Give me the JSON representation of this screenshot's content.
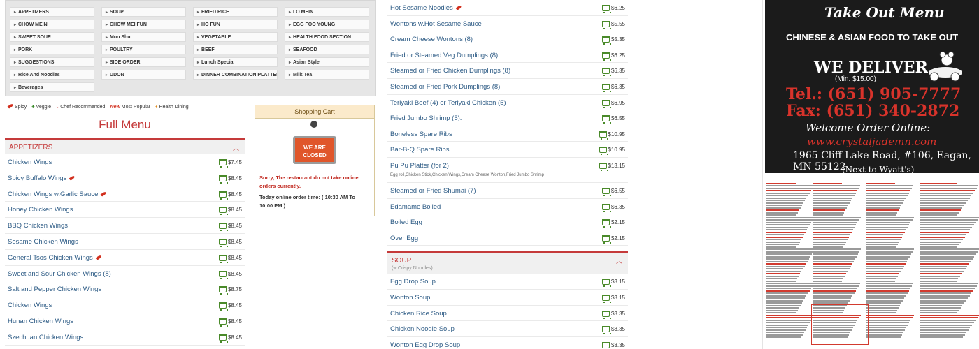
{
  "categories": [
    "APPETIZERS",
    "SOUP",
    "FRIED RICE",
    "LO MEIN",
    "CHOW MEIN",
    "CHOW MEI FUN",
    "HO FUN",
    "EGG FOO YOUNG",
    "SWEET SOUR",
    "Moo Shu",
    "VEGETABLE",
    "HEALTH FOOD SECTION",
    "PORK",
    "POULTRY",
    "BEEF",
    "SEAFOOD",
    "SUGGESTIONS",
    "SIDE ORDER",
    "Lunch Special",
    "Asian Style",
    "Rice And Noodles",
    "UDON",
    "DINNER COMBINATION PLATTER",
    "Milk Tea",
    "Beverages"
  ],
  "legend": {
    "spicy": "Spicy",
    "veggie": "Veggie",
    "chef": "Chef Recommended",
    "new": "New",
    "popular": "Most Popular",
    "health": "Health Dining"
  },
  "full_menu_title": "Full Menu",
  "appetizers_header": "APPETIZERS",
  "appetizers": [
    {
      "name": "Chicken Wings",
      "price": "$7.45",
      "spicy": false
    },
    {
      "name": "Spicy Buffalo Wings",
      "price": "$8.45",
      "spicy": true
    },
    {
      "name": "Chicken Wings w.Garlic Sauce",
      "price": "$8.45",
      "spicy": true
    },
    {
      "name": "Honey Chicken Wings",
      "price": "$8.45",
      "spicy": false
    },
    {
      "name": "BBQ Chicken Wings",
      "price": "$8.45",
      "spicy": false
    },
    {
      "name": "Sesame Chicken Wings",
      "price": "$8.45",
      "spicy": false
    },
    {
      "name": "General Tsos Chicken Wings",
      "price": "$8.45",
      "spicy": true
    },
    {
      "name": "Sweet and Sour Chicken Wings (8)",
      "price": "$8.45",
      "spicy": false
    },
    {
      "name": "Salt and Pepper Chicken Wings",
      "price": "$8.75",
      "spicy": false
    },
    {
      "name": "Chicken Wings",
      "price": "$8.45",
      "spicy": false
    },
    {
      "name": "Hunan Chicken Wings",
      "price": "$8.45",
      "spicy": false
    },
    {
      "name": "Szechuan Chicken Wings",
      "price": "$8.45",
      "spicy": false
    }
  ],
  "cart": {
    "header": "Shopping Cart",
    "sign_text_1": "WE ARE",
    "sign_text_2": "CLOSED",
    "closed_msg": "Sorry, The restaurant do not take online orders currently.",
    "time_msg": "Today online order time: ( 10:30 AM   To 10:00 PM )"
  },
  "middle_items": [
    {
      "name": "Hot Sesame Noodles",
      "price": "$6.25",
      "spicy": true
    },
    {
      "name": "Wontons w.Hot Sesame Sauce",
      "price": "$5.55",
      "spicy": false
    },
    {
      "name": "Cream Cheese Wontons (8)",
      "price": "$5.35",
      "spicy": false
    },
    {
      "name": "Fried or Steamed Veg.Dumplings (8)",
      "price": "$6.25",
      "spicy": false
    },
    {
      "name": "Steamed or Fried Chicken Dumplings (8)",
      "price": "$6.35",
      "spicy": false
    },
    {
      "name": "Steamed or Fried Pork Dumplings (8)",
      "price": "$6.35",
      "spicy": false
    },
    {
      "name": "Teriyaki Beef (4) or Teriyaki Chicken (5)",
      "price": "$6.95",
      "spicy": false
    },
    {
      "name": "Fried Jumbo Shrimp (5).",
      "price": "$6.55",
      "spicy": false
    },
    {
      "name": "Boneless Spare Ribs",
      "price": "$10.95",
      "spicy": false
    },
    {
      "name": "Bar-B-Q Spare Ribs.",
      "price": "$10.95",
      "spicy": false
    },
    {
      "name": "Pu Pu Platter (for 2)",
      "price": "$13.15",
      "spicy": false,
      "note": "Egg roll,Chicken Stick,Chicken Wings,Cream Cheese Wonton,Fried Jumbo Shrimp"
    },
    {
      "name": "Steamed or Fried Shumai (7)",
      "price": "$6.55",
      "spicy": false
    },
    {
      "name": "Edamame Boiled",
      "price": "$6.35",
      "spicy": false
    },
    {
      "name": "Boiled Egg",
      "price": "$2.15",
      "spicy": false
    },
    {
      "name": "Over Egg",
      "price": "$2.15",
      "spicy": false
    }
  ],
  "soup_header": "SOUP",
  "soup_sub": "(w.Crispy Noodles)",
  "soups": [
    {
      "name": "Egg Drop Soup",
      "price": "$3.15"
    },
    {
      "name": "Wonton Soup",
      "price": "$3.15"
    },
    {
      "name": "Chicken Rice Soup",
      "price": "$3.35"
    },
    {
      "name": "Chicken Noodle Soup",
      "price": "$3.35"
    },
    {
      "name": "Wonton Egg Drop Soup",
      "price": "$3.35"
    }
  ],
  "menu_image": {
    "title": "Take Out Menu",
    "subtitle": "CHINESE & ASIAN FOOD TO TAKE OUT",
    "deliver": "WE DELIVER",
    "min": "(Min. $15.00)",
    "tel": "Tel.: (651) 905-7777",
    "fax": "Fax: (651) 340-2872",
    "welcome": "Welcome Order Online:",
    "url": "www.crystaljademn.com",
    "address": "1965 Cliff Lake Road, #106, Eagan, MN 55122",
    "next": "(Next to Wyatt's)"
  }
}
